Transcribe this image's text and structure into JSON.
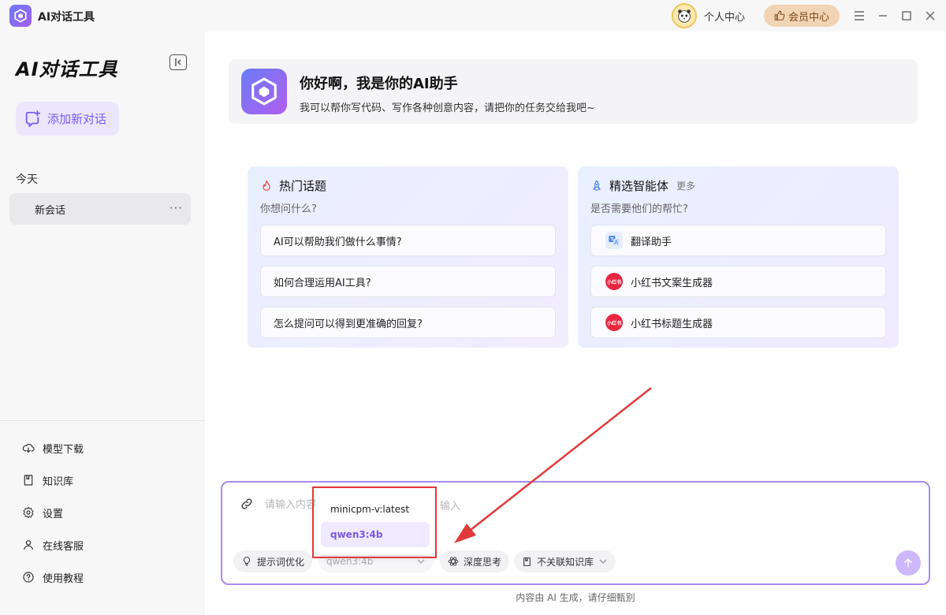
{
  "app": {
    "title": "AI对话工具",
    "personal_center": "个人中心",
    "vip_label": "会员中心"
  },
  "sidebar": {
    "title": "AI对话工具",
    "new_chat": "添加新对话",
    "today": "今天",
    "session": "新会话",
    "session_more": "···",
    "nav": [
      {
        "label": "模型下载",
        "icon": "cloud-download-icon"
      },
      {
        "label": "知识库",
        "icon": "book-icon"
      },
      {
        "label": "设置",
        "icon": "gear-icon"
      },
      {
        "label": "在线客服",
        "icon": "user-icon"
      },
      {
        "label": "使用教程",
        "icon": "help-icon"
      }
    ]
  },
  "welcome": {
    "title": "你好啊，我是你的AI助手",
    "subtitle": "我可以帮你写代码、写作各种创意内容，请把你的任务交给我吧~"
  },
  "hot_topics": {
    "title": "热门话题",
    "subtitle": "你想问什么?",
    "items": [
      "AI可以帮助我们做什么事情?",
      "如何合理运用AI工具?",
      "怎么提问可以得到更准确的回复?"
    ]
  },
  "agents": {
    "title": "精选智能体",
    "more": "更多",
    "subtitle": "是否需要他们的帮忙?",
    "items": [
      {
        "label": "翻译助手",
        "icon": "translate-icon"
      },
      {
        "label": "小红书文案生成器",
        "icon": "xiaohongshu-icon",
        "badge": "小红书"
      },
      {
        "label": "小红书标题生成器",
        "icon": "xiaohongshu-icon",
        "badge": "小红书"
      }
    ]
  },
  "composer": {
    "placeholder_left": "请输入内容",
    "placeholder_right": "输入",
    "prompt_opt": "提示词优化",
    "model": "qwen3:4b",
    "deep_think": "深度思考",
    "knowledge": "不关联知识库"
  },
  "dropdown": {
    "options": [
      "minicpm-v:latest",
      "qwen3:4b"
    ],
    "selected": "qwen3:4b"
  },
  "disclaimer": "内容由 AI 生成，请仔细甄别",
  "colors": {
    "accent": "#7c5cf0",
    "highlight": "#e03a3a",
    "vip": "#f1d4b3"
  }
}
